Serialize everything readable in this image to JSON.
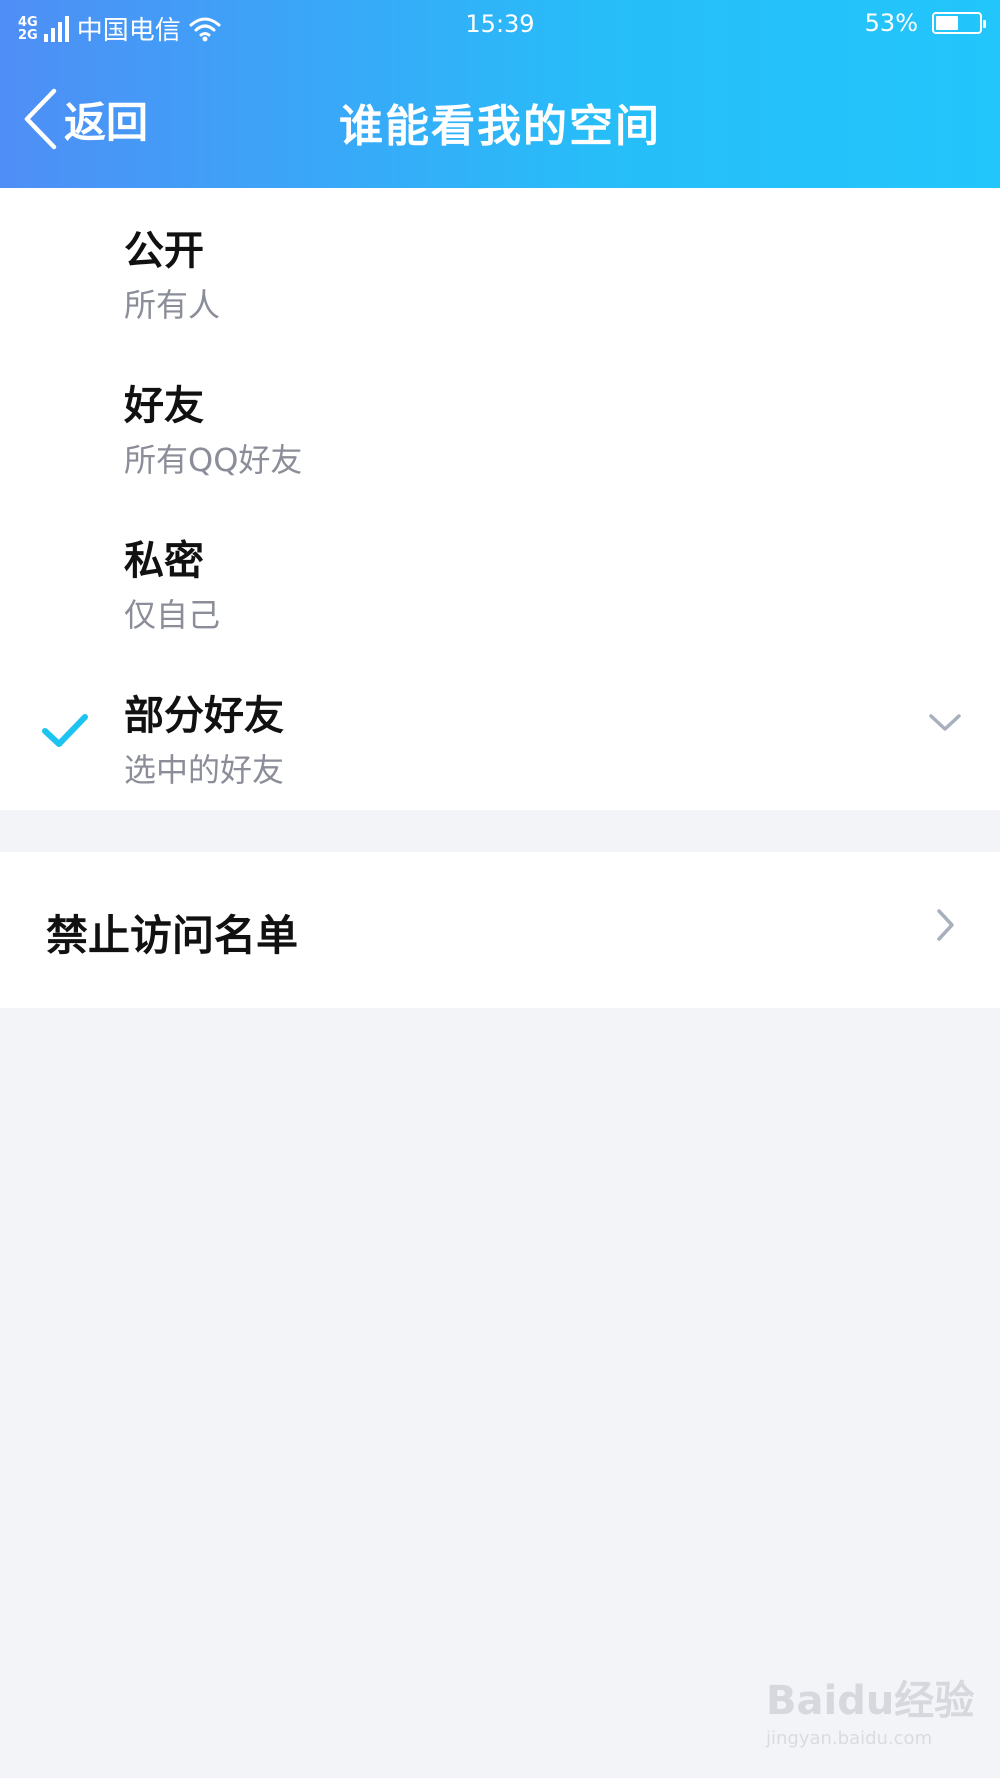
{
  "status": {
    "network_top": "4G",
    "network_bottom": "2G",
    "carrier": "中国电信",
    "time": "15:39",
    "battery_text": "53%",
    "battery_level": 0.53,
    "wifi_icon": "wifi-icon"
  },
  "nav": {
    "back_label": "返回",
    "title": "谁能看我的空间"
  },
  "options": [
    {
      "title": "公开",
      "subtitle": "所有人",
      "selected": false
    },
    {
      "title": "好友",
      "subtitle": "所有QQ好友",
      "selected": false
    },
    {
      "title": "私密",
      "subtitle": "仅自己",
      "selected": false
    },
    {
      "title": "部分好友",
      "subtitle": "选中的好友",
      "selected": true
    }
  ],
  "blocked": {
    "label": "禁止访问名单"
  },
  "watermark": {
    "brand": "Baidu经验",
    "url": "jingyan.baidu.com"
  },
  "colors": {
    "header_start": "#4f8ef6",
    "header_end": "#22c6fb",
    "check": "#1ec4f0",
    "chevron": "#a9b0bd",
    "background": "#f3f4f8"
  }
}
